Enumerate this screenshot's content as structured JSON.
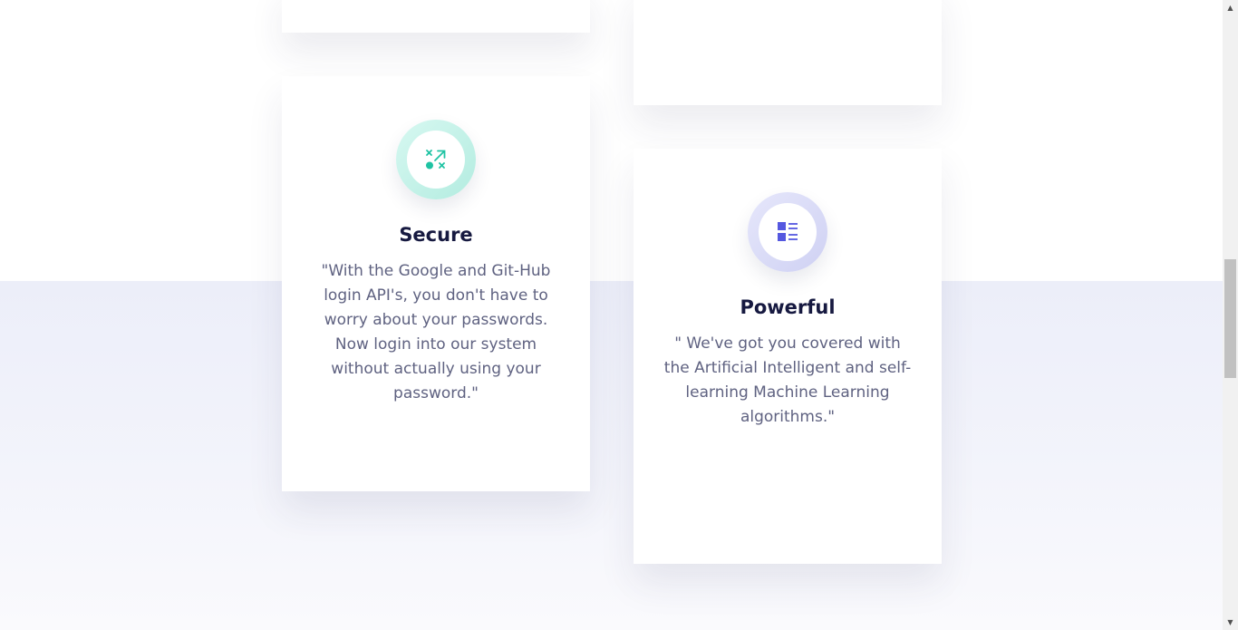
{
  "features": {
    "secure": {
      "icon": "strategy-icon",
      "accent": "#1fc3a3",
      "title": "Secure",
      "text": "\"With the Google and Git-Hub login API's, you don't have to worry about your passwords. Now login into our system without actually using your password.\""
    },
    "powerful": {
      "icon": "list-icon",
      "accent": "#5558e0",
      "title": "Powerful",
      "text": "\" We've got you covered with the Artificial Intelligent and self-learning Machine Learning algorithms.\""
    }
  },
  "scrollbar": {
    "up_arrow": "▲",
    "down_arrow": "▼"
  }
}
